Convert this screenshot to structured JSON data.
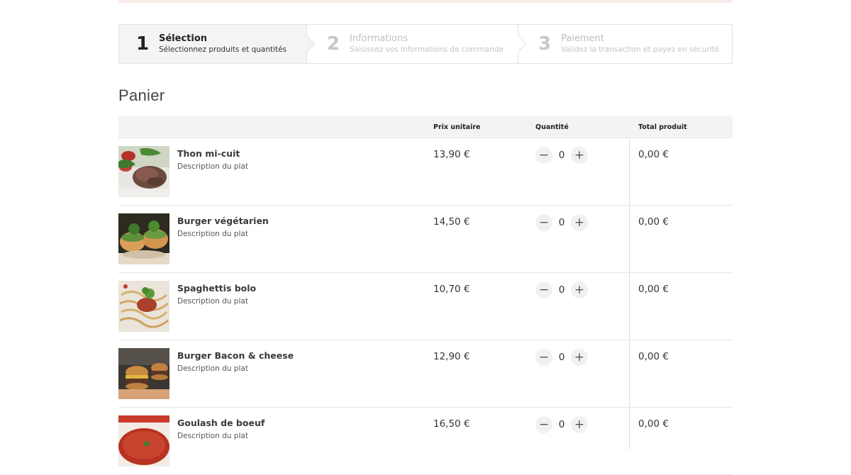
{
  "colors": {
    "topbar": "#fbeaea",
    "active_step_bg": "#f4f4f4",
    "inactive_text": "#bfbfbf"
  },
  "stepper": {
    "steps": [
      {
        "num": "1",
        "title": "Sélection",
        "subtitle": "Sélectionnez produits et quantités",
        "active": true
      },
      {
        "num": "2",
        "title": "Informations",
        "subtitle": "Saisissez vos informations de commande",
        "active": false
      },
      {
        "num": "3",
        "title": "Paiement",
        "subtitle": "Validez la transaction et payez en sécurité",
        "active": false
      }
    ]
  },
  "cart": {
    "title": "Panier",
    "headers": {
      "price": "Prix unitaire",
      "quantity": "Quantité",
      "total": "Total produit"
    },
    "items": [
      {
        "name": "Thon mi-cuit",
        "description": "Description du plat",
        "price": "13,90 €",
        "quantity": "0",
        "total": "0,00 €",
        "image": "tuna-salad-photo"
      },
      {
        "name": "Burger végétarien",
        "description": "Description du plat",
        "price": "14,50 €",
        "quantity": "0",
        "total": "0,00 €",
        "image": "veggie-burger-photo"
      },
      {
        "name": "Spaghettis bolo",
        "description": "Description du plat",
        "price": "10,70 €",
        "quantity": "0",
        "total": "0,00 €",
        "image": "spaghetti-photo"
      },
      {
        "name": "Burger Bacon & cheese",
        "description": "Description du plat",
        "price": "12,90 €",
        "quantity": "0",
        "total": "0,00 €",
        "image": "bacon-burger-photo"
      },
      {
        "name": "Goulash de boeuf",
        "description": "Description du plat",
        "price": "16,50 €",
        "quantity": "0",
        "total": "0,00 €",
        "image": "goulash-photo"
      }
    ],
    "qty_buttons": {
      "minus": "−",
      "plus": "+"
    }
  }
}
